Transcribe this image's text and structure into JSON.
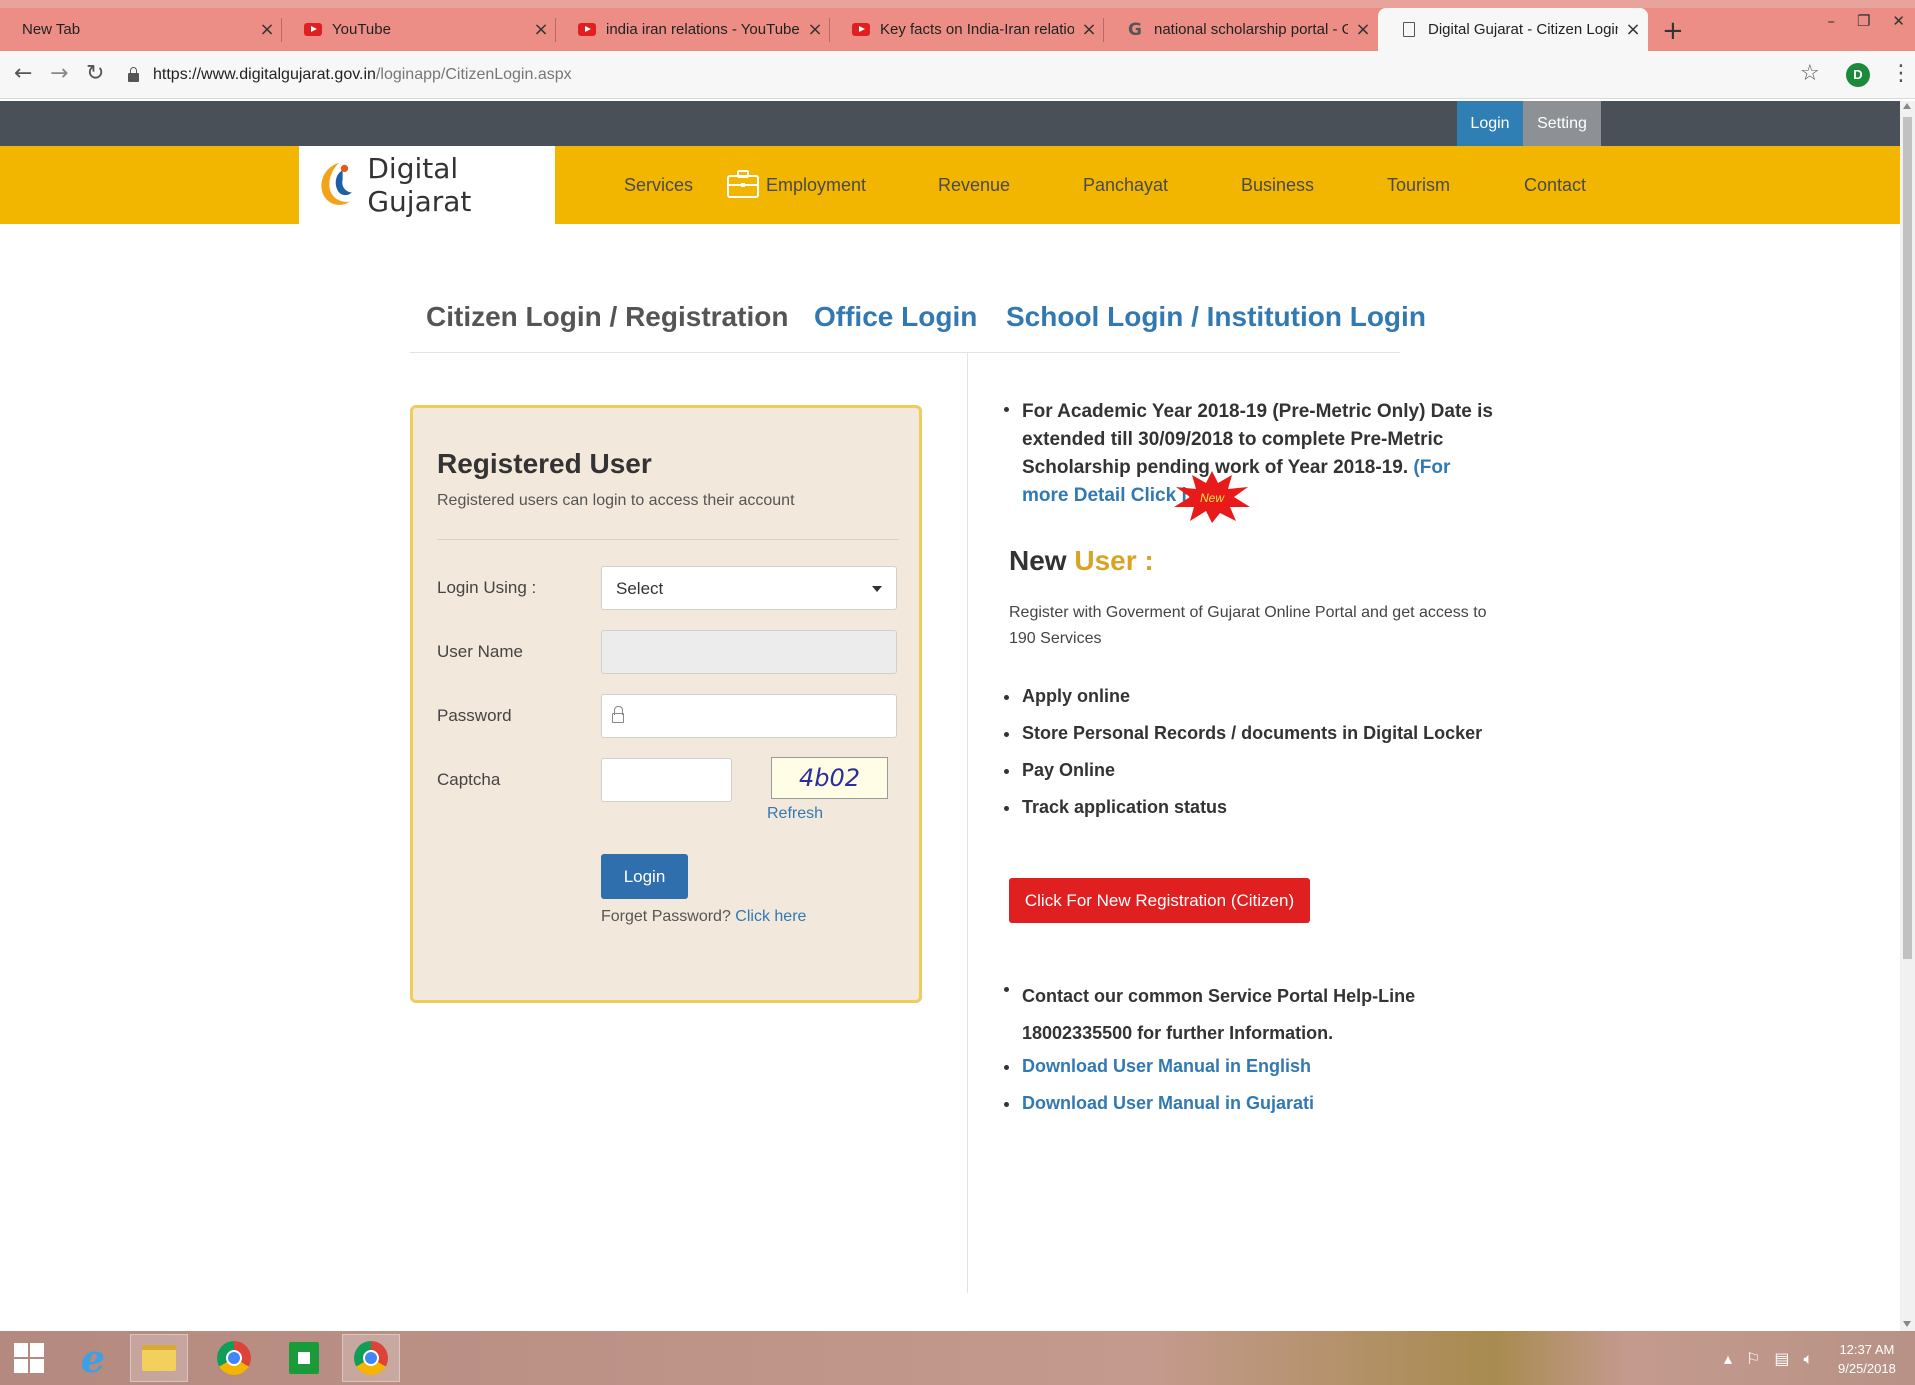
{
  "browser": {
    "tabs": [
      {
        "title": "New Tab",
        "icon": "none"
      },
      {
        "title": "YouTube",
        "icon": "youtube-icon"
      },
      {
        "title": "india iran relations - YouTube",
        "icon": "youtube-icon"
      },
      {
        "title": "Key facts on India-Iran relations -",
        "icon": "youtube-icon"
      },
      {
        "title": "national scholarship portal - Goo",
        "icon": "google-icon"
      },
      {
        "title": "Digital Gujarat - Citizen Login",
        "icon": "page-icon"
      }
    ],
    "url_host": "https://www.digitalgujarat.gov.in",
    "url_path": "/loginapp/CitizenLogin.aspx",
    "profile_initial": "D"
  },
  "site": {
    "top_login": "Login",
    "top_setting": "Setting",
    "logo_text": "Digital Gujarat",
    "nav": [
      "Services",
      "Employment",
      "Revenue",
      "Panchayat",
      "Business",
      "Tourism",
      "Contact"
    ],
    "login_tabs": {
      "citizen": "Citizen Login / Registration",
      "office": "Office Login",
      "school": "School Login / Institution Login"
    },
    "panel": {
      "title": "Registered User",
      "subtitle": "Registered users can login to access their account",
      "login_using_label": "Login Using :",
      "login_using_value": "Select",
      "username_label": "User Name",
      "password_label": "Password",
      "captcha_label": "Captcha",
      "captcha_code": "4b02",
      "refresh": "Refresh",
      "login_button": "Login",
      "forgot_text": "Forget Password?",
      "forgot_link": "Click here"
    },
    "notice": {
      "text": "For Academic Year 2018-19 (Pre-Metric Only) Date is extended till 30/09/2018 to complete Pre-Metric Scholarship pending work of Year 2018-19.",
      "link": "(For more Detail Click here)",
      "badge": "New"
    },
    "new_user": {
      "title_part1": "New",
      "title_part2": "User :",
      "description": "Register with Goverment of Gujarat Online Portal and get access to 190 Services",
      "features": [
        "Apply online",
        "Store Personal Records / documents in Digital Locker",
        "Pay Online",
        "Track application status"
      ],
      "register_button": "Click For New Registration (Citizen)"
    },
    "contact_text": "Contact our common Service Portal Help-Line 18002335500 for further Information.",
    "downloads": [
      "Download User Manual in English",
      "Download User Manual in Gujarati"
    ]
  },
  "taskbar": {
    "time": "12:37 AM",
    "date": "9/25/2018"
  },
  "colors": {
    "nav_yellow": "#f2b600",
    "link_blue": "#3279b3",
    "register_red": "#e02020",
    "login_blue": "#2f6fad"
  }
}
